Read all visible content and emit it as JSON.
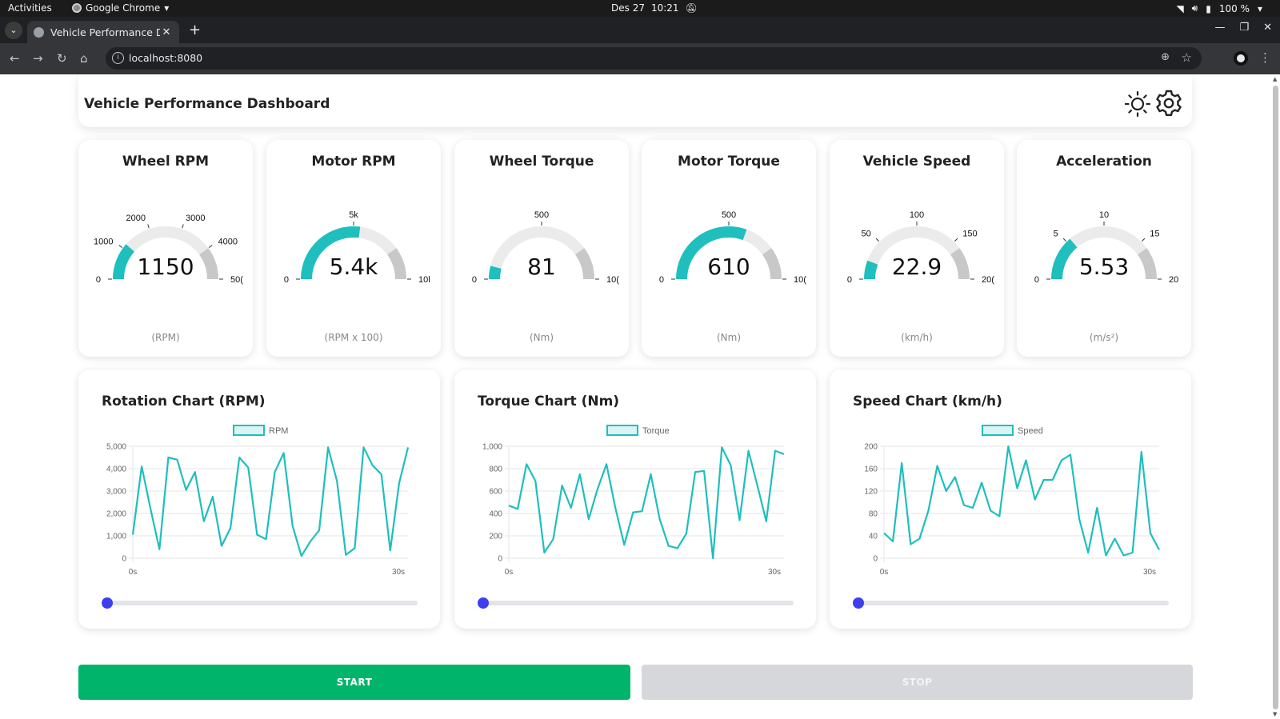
{
  "system_bar": {
    "activities": "Activities",
    "app_name": "Google Chrome",
    "date": "Des 27",
    "time": "10:21",
    "battery": "100 %"
  },
  "browser": {
    "tab_title": "Vehicle Performance Da",
    "url": "localhost:8080"
  },
  "header": {
    "title": "Vehicle Performance Dashboard"
  },
  "colors": {
    "accent": "#1ebfbd",
    "start": "#00b56b",
    "stop": "#d6d7da",
    "slider": "#3e3ef0"
  },
  "gauges": [
    {
      "title": "Wheel RPM",
      "value_text": "1150",
      "value": 1150,
      "min": 0,
      "max": 5000,
      "unit": "(RPM)",
      "ticks": [
        {
          "v": 0,
          "label": "0"
        },
        {
          "v": 1000,
          "label": "1000"
        },
        {
          "v": 2000,
          "label": "2000"
        },
        {
          "v": 3000,
          "label": "3000"
        },
        {
          "v": 4000,
          "label": "4000"
        },
        {
          "v": 5000,
          "label": "50("
        }
      ]
    },
    {
      "title": "Motor RPM",
      "value_text": "5.4k",
      "value": 5400,
      "min": 0,
      "max": 10000,
      "unit": "(RPM x 100)",
      "ticks": [
        {
          "v": 0,
          "label": "0"
        },
        {
          "v": 5000,
          "label": "5k"
        },
        {
          "v": 10000,
          "label": "10l"
        }
      ]
    },
    {
      "title": "Wheel Torque",
      "value_text": "81",
      "value": 81,
      "min": 0,
      "max": 1000,
      "unit": "(Nm)",
      "ticks": [
        {
          "v": 0,
          "label": "0"
        },
        {
          "v": 500,
          "label": "500"
        },
        {
          "v": 1000,
          "label": "10("
        }
      ]
    },
    {
      "title": "Motor Torque",
      "value_text": "610",
      "value": 610,
      "min": 0,
      "max": 1000,
      "unit": "(Nm)",
      "ticks": [
        {
          "v": 0,
          "label": "0"
        },
        {
          "v": 500,
          "label": "500"
        },
        {
          "v": 1000,
          "label": "10("
        }
      ]
    },
    {
      "title": "Vehicle Speed",
      "value_text": "22.9",
      "value": 22.9,
      "min": 0,
      "max": 200,
      "unit": "(km/h)",
      "ticks": [
        {
          "v": 0,
          "label": "0"
        },
        {
          "v": 50,
          "label": "50"
        },
        {
          "v": 100,
          "label": "100"
        },
        {
          "v": 150,
          "label": "150"
        },
        {
          "v": 200,
          "label": "20("
        }
      ]
    },
    {
      "title": "Acceleration",
      "value_text": "5.53",
      "value": 5.53,
      "min": 0,
      "max": 20,
      "unit": "(m/s²)",
      "ticks": [
        {
          "v": 0,
          "label": "0"
        },
        {
          "v": 5,
          "label": "5"
        },
        {
          "v": 10,
          "label": "10"
        },
        {
          "v": 15,
          "label": "15"
        },
        {
          "v": 20,
          "label": "20"
        }
      ]
    }
  ],
  "chart_data": [
    {
      "type": "line",
      "title": "Rotation Chart (RPM)",
      "ylim": [
        0,
        5000
      ],
      "yticks": [
        "0",
        "1,000",
        "2,000",
        "3,000",
        "4,000",
        "5,000"
      ],
      "yticks_values": [
        0,
        1000,
        2000,
        3000,
        4000,
        5000
      ],
      "x_labels": [
        "0s",
        "30s"
      ],
      "grid": true,
      "legend_position": "top",
      "series": [
        {
          "name": "RPM",
          "values": [
            1050,
            4100,
            2200,
            400,
            4500,
            4400,
            3050,
            3850,
            1650,
            2750,
            550,
            1350,
            4500,
            4050,
            1050,
            850,
            3850,
            4700,
            1450,
            100,
            750,
            1250,
            4950,
            3450,
            150,
            450,
            4950,
            4150,
            3750,
            350,
            3350,
            4950
          ]
        }
      ]
    },
    {
      "type": "line",
      "title": "Torque Chart (Nm)",
      "ylim": [
        0,
        1000
      ],
      "yticks": [
        "0",
        "200",
        "400",
        "600",
        "800",
        "1,000"
      ],
      "yticks_values": [
        0,
        200,
        400,
        600,
        800,
        1000
      ],
      "x_labels": [
        "0s",
        "30s"
      ],
      "grid": true,
      "legend_position": "top",
      "series": [
        {
          "name": "Torque",
          "values": [
            470,
            440,
            840,
            690,
            50,
            170,
            650,
            450,
            750,
            350,
            620,
            840,
            450,
            120,
            410,
            420,
            750,
            350,
            110,
            90,
            220,
            770,
            780,
            0,
            990,
            830,
            340,
            960,
            650,
            330,
            960,
            930
          ]
        }
      ]
    },
    {
      "type": "line",
      "title": "Speed Chart (km/h)",
      "ylim": [
        0,
        200
      ],
      "yticks": [
        "0",
        "40",
        "80",
        "120",
        "160",
        "200"
      ],
      "yticks_values": [
        0,
        40,
        80,
        120,
        160,
        200
      ],
      "x_labels": [
        "0s",
        "30s"
      ],
      "grid": true,
      "legend_position": "top",
      "series": [
        {
          "name": "Speed",
          "values": [
            45,
            30,
            170,
            25,
            35,
            85,
            165,
            120,
            145,
            95,
            90,
            135,
            85,
            75,
            200,
            125,
            175,
            105,
            140,
            140,
            175,
            185,
            70,
            10,
            90,
            5,
            35,
            5,
            10,
            190,
            45,
            15
          ]
        }
      ]
    }
  ],
  "controls": {
    "start_label": "START",
    "stop_label": "STOP"
  }
}
